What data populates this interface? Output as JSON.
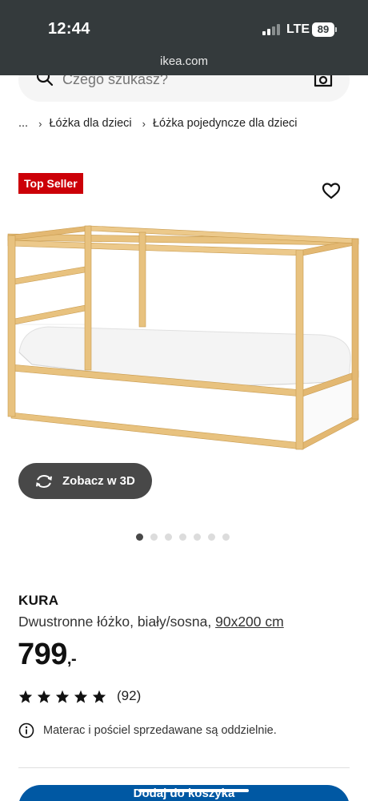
{
  "status_bar": {
    "time": "12:44",
    "network": "LTE",
    "battery": "89"
  },
  "browser": {
    "url": "ikea.com"
  },
  "search": {
    "placeholder": "Czego szukasz?"
  },
  "breadcrumb": {
    "ellipsis": "...",
    "items": [
      "Łóżka dla dzieci",
      "Łóżka pojedyncze dla dzieci"
    ]
  },
  "badge": {
    "label": "Top Seller",
    "color": "#cc0008"
  },
  "view3d": {
    "label": "Zobacz w 3D"
  },
  "carousel": {
    "total": 7,
    "active_index": 0
  },
  "product": {
    "name": "KURA",
    "description": "Dwustronne łóżko, biały/sosna,",
    "size_link": "90x200 cm",
    "price": "799",
    "price_suffix": ",-",
    "rating_stars": 5,
    "review_count": "(92)",
    "notice": "Materac i pościel sprzedawane są oddzielnie."
  },
  "cta": {
    "label": "Dodaj do koszyka",
    "color": "#0058a3"
  },
  "colors": {
    "status_bar": "#343a3c",
    "wood": "#e8c27f",
    "panel": "#ffffff"
  }
}
